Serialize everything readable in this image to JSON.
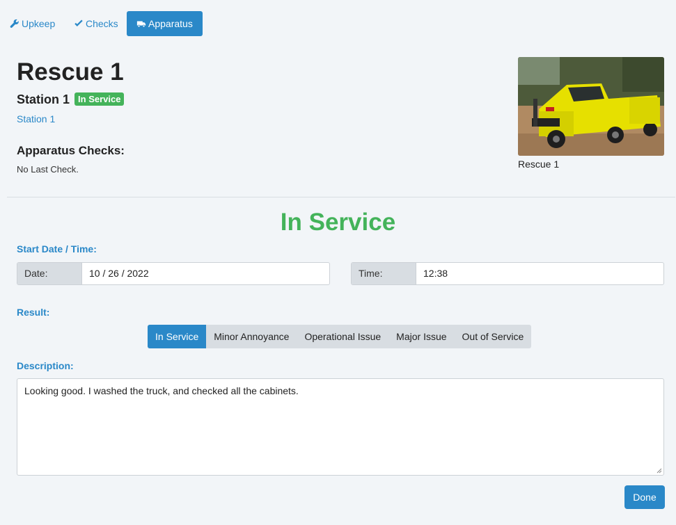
{
  "nav": {
    "items": [
      {
        "label": "Upkeep",
        "icon": "wrench-icon"
      },
      {
        "label": "Checks",
        "icon": "check-icon"
      },
      {
        "label": "Apparatus",
        "icon": "truck-icon"
      }
    ],
    "active_index": 2
  },
  "apparatus": {
    "title": "Rescue 1",
    "station": "Station 1",
    "status_badge": "In Service",
    "station_link": "Station 1",
    "checks_heading": "Apparatus Checks:",
    "last_check": "No Last Check.",
    "photo_caption": "Rescue 1"
  },
  "form": {
    "status_heading": "In Service",
    "start_label": "Start Date / Time:",
    "date_label": "Date:",
    "date_value": "10 / 26 / 2022",
    "time_label": "Time:",
    "time_value": "12:38",
    "result_label": "Result:",
    "results": [
      "In Service",
      "Minor Annoyance",
      "Operational Issue",
      "Major Issue",
      "Out of Service"
    ],
    "selected_result": "In Service",
    "description_label": "Description:",
    "description": "Looking good. I washed the truck, and checked all the cabinets.",
    "done_label": "Done"
  },
  "colors": {
    "accent": "#2a88c8",
    "success": "#44b35a",
    "background": "#f2f5f8"
  }
}
